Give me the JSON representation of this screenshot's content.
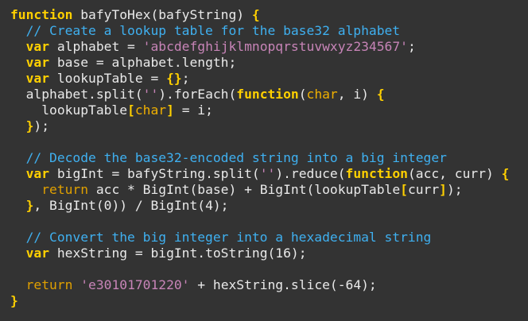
{
  "colors": {
    "background": "#333333",
    "keyword": "#ffd000",
    "keyword_secondary": "#e0a000",
    "comment": "#3fb0f0",
    "string": "#c784b7",
    "parameter": "#f0b000",
    "text": "#e9e9e9"
  },
  "code": {
    "lines": [
      [
        {
          "t": "function",
          "k": "keyword"
        },
        {
          "t": " bafyToHex(bafyString) ",
          "k": "plain"
        },
        {
          "t": "{",
          "k": "brace"
        }
      ],
      [
        {
          "t": "  // Create a lookup table for the base32 alphabet",
          "k": "comment"
        }
      ],
      [
        {
          "t": "  ",
          "k": "plain"
        },
        {
          "t": "var",
          "k": "keyword"
        },
        {
          "t": " alphabet = ",
          "k": "plain"
        },
        {
          "t": "'abcdefghijklmnopqrstuvwxyz234567'",
          "k": "string"
        },
        {
          "t": ";",
          "k": "plain"
        }
      ],
      [
        {
          "t": "  ",
          "k": "plain"
        },
        {
          "t": "var",
          "k": "keyword"
        },
        {
          "t": " base = alphabet.length;",
          "k": "plain"
        }
      ],
      [
        {
          "t": "  ",
          "k": "plain"
        },
        {
          "t": "var",
          "k": "keyword"
        },
        {
          "t": " lookupTable = ",
          "k": "plain"
        },
        {
          "t": "{}",
          "k": "brace"
        },
        {
          "t": ";",
          "k": "plain"
        }
      ],
      [
        {
          "t": "  alphabet.split(",
          "k": "plain"
        },
        {
          "t": "''",
          "k": "string"
        },
        {
          "t": ").forEach(",
          "k": "plain"
        },
        {
          "t": "function",
          "k": "keyword"
        },
        {
          "t": "(",
          "k": "plain"
        },
        {
          "t": "char",
          "k": "param"
        },
        {
          "t": ", i) ",
          "k": "plain"
        },
        {
          "t": "{",
          "k": "brace"
        }
      ],
      [
        {
          "t": "    lookupTable",
          "k": "plain"
        },
        {
          "t": "[",
          "k": "brace"
        },
        {
          "t": "char",
          "k": "param"
        },
        {
          "t": "]",
          "k": "brace"
        },
        {
          "t": " = i;",
          "k": "plain"
        }
      ],
      [
        {
          "t": "  ",
          "k": "plain"
        },
        {
          "t": "}",
          "k": "brace"
        },
        {
          "t": ");",
          "k": "plain"
        }
      ],
      [
        {
          "t": "",
          "k": "plain"
        }
      ],
      [
        {
          "t": "  // Decode the base32-encoded string into a big integer",
          "k": "comment"
        }
      ],
      [
        {
          "t": "  ",
          "k": "plain"
        },
        {
          "t": "var",
          "k": "keyword"
        },
        {
          "t": " bigInt = bafyString.split(",
          "k": "plain"
        },
        {
          "t": "''",
          "k": "string"
        },
        {
          "t": ").reduce(",
          "k": "plain"
        },
        {
          "t": "function",
          "k": "keyword"
        },
        {
          "t": "(acc, curr) ",
          "k": "plain"
        },
        {
          "t": "{",
          "k": "brace"
        }
      ],
      [
        {
          "t": "    ",
          "k": "plain"
        },
        {
          "t": "return",
          "k": "keyword2"
        },
        {
          "t": " acc * BigInt(base) + BigInt(lookupTable",
          "k": "plain"
        },
        {
          "t": "[",
          "k": "brace"
        },
        {
          "t": "curr",
          "k": "plain"
        },
        {
          "t": "]",
          "k": "brace"
        },
        {
          "t": ");",
          "k": "plain"
        }
      ],
      [
        {
          "t": "  ",
          "k": "plain"
        },
        {
          "t": "}",
          "k": "brace"
        },
        {
          "t": ", BigInt(0)) / BigInt(4);",
          "k": "plain"
        }
      ],
      [
        {
          "t": "",
          "k": "plain"
        }
      ],
      [
        {
          "t": "  // Convert the big integer into a hexadecimal string",
          "k": "comment"
        }
      ],
      [
        {
          "t": "  ",
          "k": "plain"
        },
        {
          "t": "var",
          "k": "keyword"
        },
        {
          "t": " hexString = bigInt.toString(16);",
          "k": "plain"
        }
      ],
      [
        {
          "t": "",
          "k": "plain"
        }
      ],
      [
        {
          "t": "  ",
          "k": "plain"
        },
        {
          "t": "return",
          "k": "keyword2"
        },
        {
          "t": " ",
          "k": "plain"
        },
        {
          "t": "'e30101701220'",
          "k": "string"
        },
        {
          "t": " + hexString.slice(-64);",
          "k": "plain"
        }
      ],
      [
        {
          "t": "}",
          "k": "brace"
        }
      ]
    ]
  }
}
